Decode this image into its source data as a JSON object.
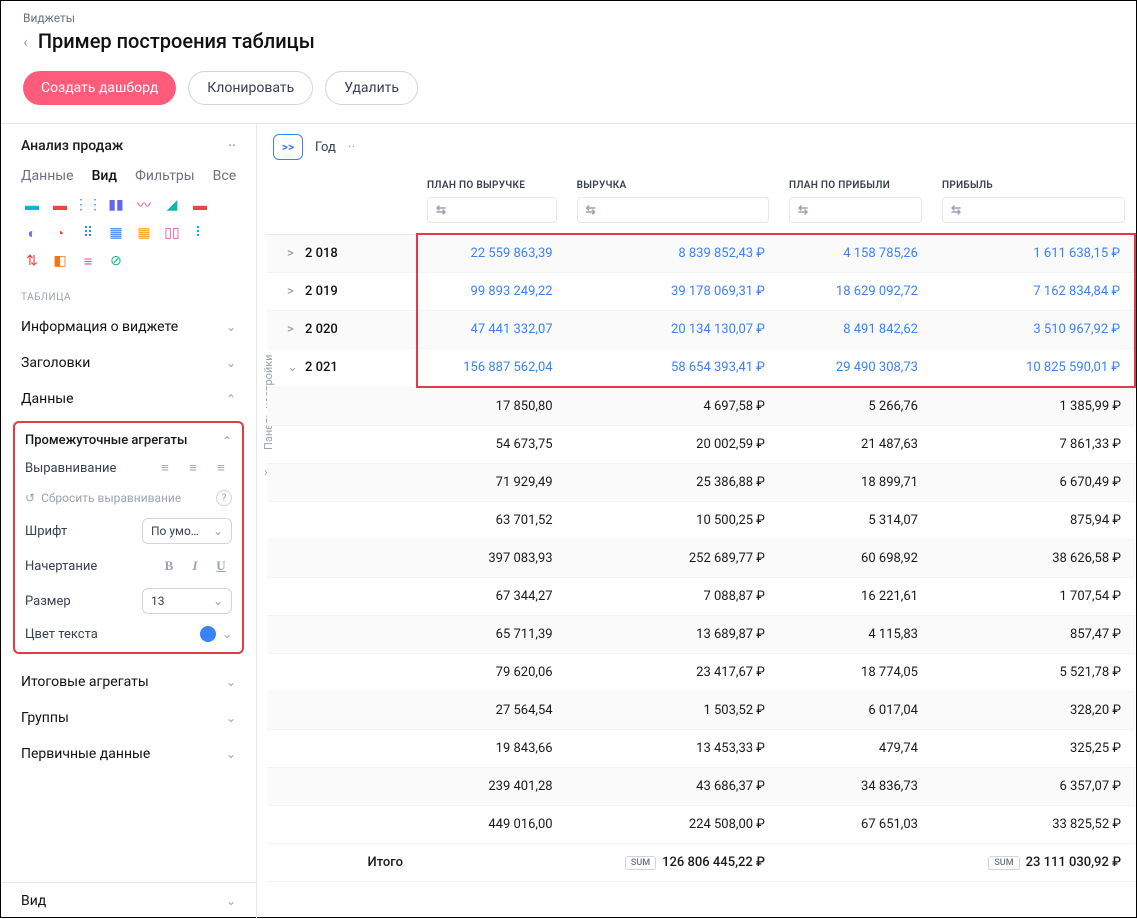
{
  "breadcrumb": "Виджеты",
  "title": "Пример построения таблицы",
  "buttons": {
    "create": "Создать дашборд",
    "clone": "Клонировать",
    "delete": "Удалить"
  },
  "side": {
    "title": "Анализ продаж",
    "tabs": {
      "data": "Данные",
      "view": "Вид",
      "filters": "Фильтры",
      "all": "Все"
    },
    "section": "Таблица",
    "acc": {
      "info": "Информация о виджете",
      "headers": "Заголовки",
      "data": "Данные",
      "interm": "Промежуточные агрегаты",
      "final": "Итоговые агрегаты",
      "groups": "Группы",
      "primary": "Первичные данные",
      "viewbtm": "Вид"
    },
    "sub": {
      "align": "Выравнивание",
      "reset": "Сбросить выравнивание",
      "font": "Шрифт",
      "fontval": "По умо…",
      "style": "Начертание",
      "size": "Размер",
      "sizeval": "13",
      "color": "Цвет текста"
    },
    "panel": "Панель настройки"
  },
  "tablehdr": {
    "expand": ">>",
    "year": "Год",
    "c1": "План по выручке",
    "c2": "Выручка",
    "c3": "План по прибыли",
    "c4": "Прибыль"
  },
  "rows": [
    {
      "y": "2 018",
      "e": ">",
      "c": [
        "22 559 863,39",
        "8 839 852,43 ₽",
        "4 158 785,26",
        "1 611 638,15 ₽"
      ]
    },
    {
      "y": "2 019",
      "e": ">",
      "c": [
        "99 893 249,22",
        "39 178 069,31 ₽",
        "18 629 092,72",
        "7 162 834,84 ₽"
      ]
    },
    {
      "y": "2 020",
      "e": ">",
      "c": [
        "47 441 332,07",
        "20 134 130,07 ₽",
        "8 491 842,62",
        "3 510 967,92 ₽"
      ]
    },
    {
      "y": "2 021",
      "e": "⌄",
      "c": [
        "156 887 562,04",
        "58 654 393,41 ₽",
        "29 490 308,73",
        "10 825 590,01 ₽"
      ]
    }
  ],
  "detail": [
    [
      "17 850,80",
      "4 697,58 ₽",
      "5 266,76",
      "1 385,99 ₽"
    ],
    [
      "54 673,75",
      "20 002,59 ₽",
      "21 487,63",
      "7 861,33 ₽"
    ],
    [
      "71 929,49",
      "25 386,88 ₽",
      "18 899,71",
      "6 670,49 ₽"
    ],
    [
      "63 701,52",
      "10 500,25 ₽",
      "5 314,07",
      "875,94 ₽"
    ],
    [
      "397 083,93",
      "252 689,77 ₽",
      "60 698,92",
      "38 626,58 ₽"
    ],
    [
      "67 344,27",
      "7 088,87 ₽",
      "16 221,61",
      "1 707,54 ₽"
    ],
    [
      "65 711,39",
      "13 689,87 ₽",
      "4 115,83",
      "857,47 ₽"
    ],
    [
      "79 620,06",
      "23 417,67 ₽",
      "18 774,05",
      "5 521,78 ₽"
    ],
    [
      "27 564,54",
      "1 503,52 ₽",
      "6 017,04",
      "328,20 ₽"
    ],
    [
      "19 843,66",
      "13 453,33 ₽",
      "479,74",
      "325,25 ₽"
    ],
    [
      "239 401,28",
      "43 686,37 ₽",
      "34 836,73",
      "6 357,07 ₽"
    ],
    [
      "449 016,00",
      "224 508,00 ₽",
      "67 651,03",
      "33 825,52 ₽"
    ]
  ],
  "total": {
    "label": "Итого",
    "sum": "SUM",
    "v2": "126 806 445,22 ₽",
    "v4": "23 111 030,92 ₽"
  }
}
